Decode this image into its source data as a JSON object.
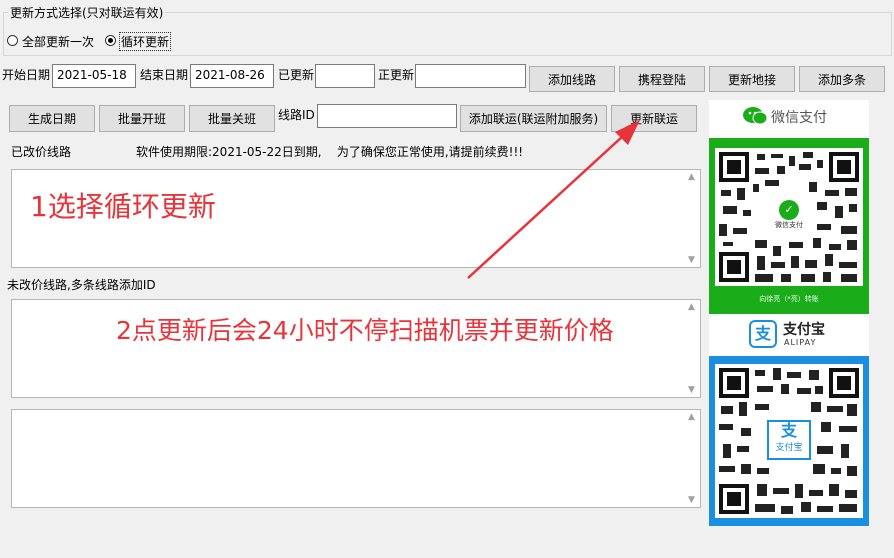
{
  "mode_group": {
    "legend": "更新方式选择(只对联运有效)",
    "options": [
      {
        "label": "全部更新一次",
        "selected": false
      },
      {
        "label": "循环更新",
        "selected": true
      }
    ]
  },
  "dates": {
    "start_label": "开始日期",
    "start_value": "2021-05-18",
    "end_label": "结束日期",
    "end_value": "2021-08-26",
    "updated_label": "已更新",
    "updated_value": "",
    "updating_label": "正更新",
    "updating_value": ""
  },
  "buttons": {
    "add_route": "添加线路",
    "ctrip_login": "携程登陆",
    "update_connect": "更新地接",
    "add_multiple": "添加多条",
    "gen_dates": "生成日期",
    "batch_open": "批量开班",
    "batch_close": "批量关班",
    "add_transit": "添加联运(联运附加服务)",
    "update_transit": "更新联运"
  },
  "route_id": {
    "label": "线路ID",
    "value": ""
  },
  "changed_routes_label": "已改价线路",
  "license_notice": "软件使用期限:2021-05-22日到期,    为了确保您正常使用,请提前续费!!!",
  "unchanged_routes_label": "未改价线路,多条线路添加ID",
  "annotations": {
    "step1": "1选择循环更新",
    "step2": "2点更新后会24小时不停扫描机票并更新价格"
  },
  "payments": {
    "wechat_title": "微信支付",
    "wechat_qr_caption": "微信支付",
    "wechat_footer": "向徐亮（*亮）转账",
    "alipay_title": "支付宝",
    "alipay_subtitle": "ALIPAY",
    "alipay_qr_caption": "支付宝",
    "wechat_color": "#1aad19",
    "alipay_color": "#1a8fe0"
  },
  "colors": {
    "annotation": "#e8333a",
    "arrow": "#e8333a"
  }
}
